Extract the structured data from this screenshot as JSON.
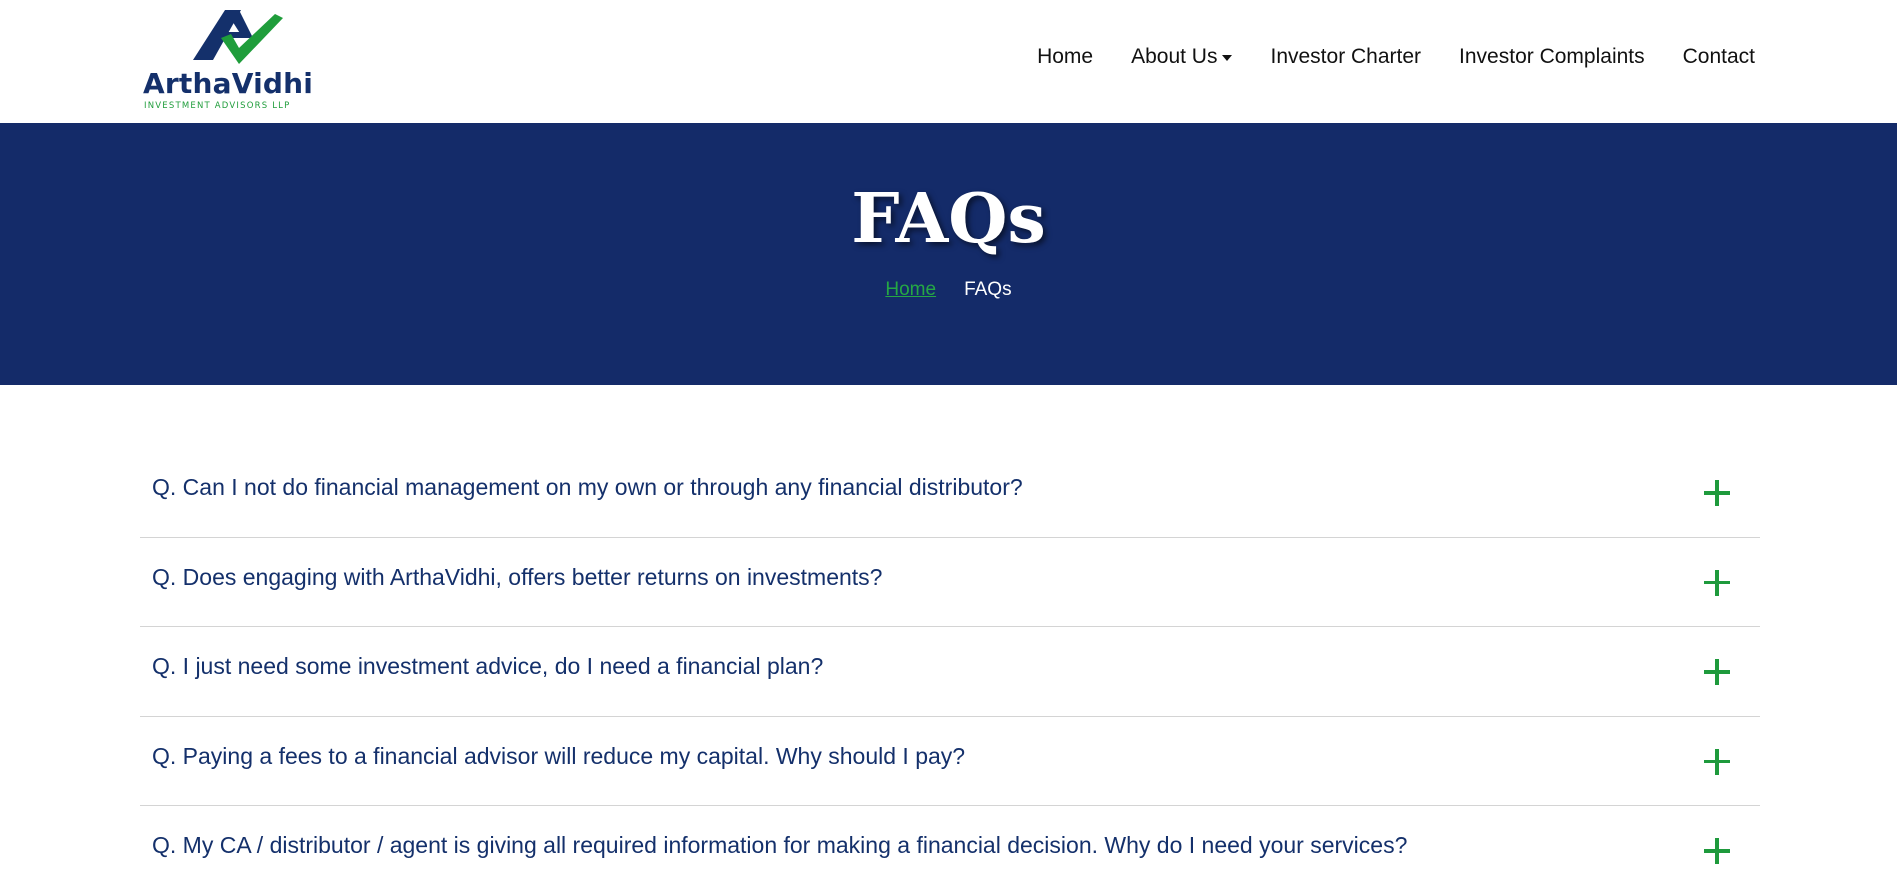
{
  "brand": {
    "name": "ArthaVidhi",
    "tagline": "INVESTMENT ADVISORS LLP",
    "colors": {
      "navy": "#14306b",
      "green": "#1f9d3b"
    }
  },
  "nav": {
    "items": [
      {
        "label": "Home"
      },
      {
        "label": "About Us",
        "has_dropdown": true
      },
      {
        "label": "Investor Charter"
      },
      {
        "label": "Investor Complaints"
      },
      {
        "label": "Contact"
      }
    ]
  },
  "banner": {
    "title": "FAQs",
    "background": "#142b69",
    "breadcrumb": {
      "home": "Home",
      "current": "FAQs"
    }
  },
  "faqs": [
    {
      "question": "Q. Can I not do financial management on my own or through any financial distributor?",
      "icon": "plus-icon"
    },
    {
      "question": "Q. Does engaging with ArthaVidhi, offers better returns on investments?",
      "icon": "plus-icon"
    },
    {
      "question": "Q. I just need some investment advice, do I need a financial plan?",
      "icon": "plus-icon"
    },
    {
      "question": "Q. Paying a fees to a financial advisor will reduce my capital. Why should I pay?",
      "icon": "plus-icon"
    },
    {
      "question": "Q. My CA / distributor / agent is giving all required information for making a financial decision. Why do I need your services?",
      "icon": "plus-icon"
    }
  ]
}
